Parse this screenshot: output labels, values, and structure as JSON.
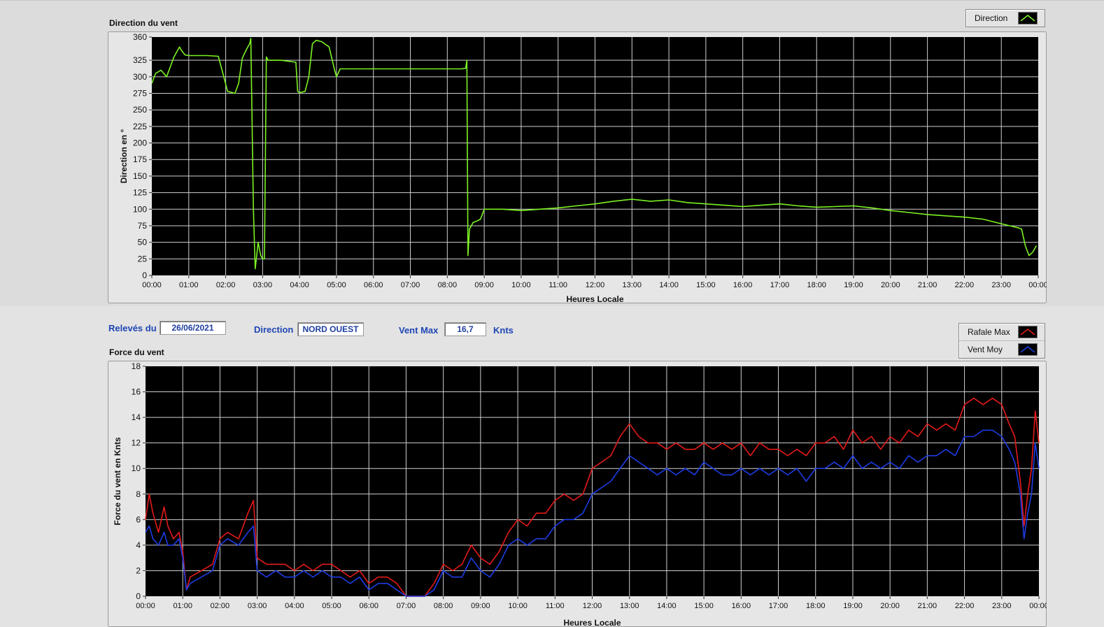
{
  "readout": {
    "date_label": "Relevés du",
    "date_value": "26/06/2021",
    "direction_label": "Direction",
    "direction_value": "NORD OUEST",
    "ventmax_label": "Vent Max",
    "ventmax_value": "16,7",
    "ventmax_unit": "Knts"
  },
  "chart_data": [
    {
      "type": "line",
      "title": "Direction du vent",
      "xlabel": "Heures Locale",
      "ylabel": "Direction en °",
      "xlim": [
        0,
        24
      ],
      "ylim": [
        0,
        360
      ],
      "x_ticks": [
        "00:00",
        "01:00",
        "02:00",
        "03:00",
        "04:00",
        "05:00",
        "06:00",
        "07:00",
        "08:00",
        "09:00",
        "10:00",
        "11:00",
        "12:00",
        "13:00",
        "14:00",
        "15:00",
        "16:00",
        "17:00",
        "18:00",
        "19:00",
        "20:00",
        "21:00",
        "22:00",
        "23:00",
        "00:00"
      ],
      "y_ticks": [
        0,
        25,
        50,
        75,
        100,
        125,
        150,
        175,
        200,
        225,
        250,
        275,
        300,
        325,
        360
      ],
      "grid": true,
      "legend_position": "top-right",
      "series": [
        {
          "name": "Direction",
          "color": "#7cf222",
          "x": [
            0,
            0.1,
            0.25,
            0.4,
            0.5,
            0.6,
            0.75,
            0.8,
            0.9,
            1.0,
            1.5,
            1.8,
            1.95,
            2.05,
            2.25,
            2.35,
            2.45,
            2.55,
            2.65,
            2.68,
            2.75,
            2.8,
            2.88,
            2.95,
            3.0,
            3.05,
            3.1,
            3.15,
            3.2,
            3.5,
            3.9,
            3.95,
            4.0,
            4.15,
            4.25,
            4.35,
            4.45,
            4.6,
            4.8,
            4.95,
            5.0,
            5.1,
            5.5,
            6.0,
            6.5,
            7.0,
            7.5,
            8.0,
            8.4,
            8.5,
            8.53,
            8.56,
            8.6,
            8.7,
            8.8,
            8.9,
            9.0,
            9.5,
            10,
            10.5,
            11,
            11.5,
            12,
            12.5,
            13,
            13.5,
            14,
            14.5,
            15,
            15.5,
            16,
            16.5,
            17,
            17.5,
            18,
            18.5,
            19,
            19.5,
            20,
            20.5,
            21,
            21.5,
            22,
            22.5,
            23,
            23.3,
            23.45,
            23.55,
            23.65,
            23.75,
            23.85,
            23.95
          ],
          "y": [
            290,
            305,
            310,
            300,
            315,
            330,
            345,
            340,
            333,
            332,
            332,
            331,
            300,
            278,
            275,
            290,
            328,
            340,
            350,
            358,
            100,
            10,
            50,
            30,
            25,
            25,
            330,
            325,
            325,
            325,
            322,
            278,
            276,
            278,
            300,
            350,
            355,
            353,
            345,
            310,
            300,
            312,
            312,
            312,
            312,
            312,
            312,
            312,
            312,
            313,
            325,
            30,
            70,
            80,
            82,
            85,
            100,
            100,
            98,
            100,
            102,
            105,
            108,
            112,
            115,
            112,
            114,
            110,
            108,
            106,
            104,
            106,
            108,
            105,
            103,
            104,
            105,
            102,
            98,
            95,
            92,
            90,
            88,
            85,
            78,
            74,
            72,
            70,
            45,
            30,
            35,
            45
          ]
        }
      ]
    },
    {
      "type": "line",
      "title": "Force du vent",
      "xlabel": "Heures Locale",
      "ylabel": "Force du vent en Knts",
      "xlim": [
        0,
        24
      ],
      "ylim": [
        0,
        18
      ],
      "x_ticks": [
        "00:00",
        "01:00",
        "02:00",
        "03:00",
        "04:00",
        "05:00",
        "06:00",
        "07:00",
        "08:00",
        "09:00",
        "10:00",
        "11:00",
        "12:00",
        "13:00",
        "14:00",
        "15:00",
        "16:00",
        "17:00",
        "18:00",
        "19:00",
        "20:00",
        "21:00",
        "22:00",
        "23:00",
        "00:00"
      ],
      "y_ticks": [
        0,
        2,
        4,
        6,
        8,
        10,
        12,
        14,
        16,
        18
      ],
      "grid": true,
      "legend_position": "top-right",
      "series": [
        {
          "name": "Rafale Max",
          "color": "#e41a1a",
          "x": [
            0,
            0.1,
            0.2,
            0.35,
            0.5,
            0.6,
            0.75,
            0.9,
            1.0,
            1.1,
            1.2,
            1.5,
            1.8,
            2.0,
            2.2,
            2.5,
            2.75,
            2.9,
            3.0,
            3.25,
            3.5,
            3.75,
            4.0,
            4.25,
            4.5,
            4.75,
            5.0,
            5.25,
            5.5,
            5.75,
            6.0,
            6.25,
            6.5,
            6.75,
            7.0,
            7.25,
            7.5,
            7.75,
            8.0,
            8.25,
            8.5,
            8.75,
            9.0,
            9.25,
            9.5,
            9.75,
            10,
            10.25,
            10.5,
            10.75,
            11,
            11.25,
            11.5,
            11.75,
            12,
            12.25,
            12.5,
            12.75,
            13,
            13.25,
            13.5,
            13.75,
            14,
            14.25,
            14.5,
            14.75,
            15,
            15.25,
            15.5,
            15.75,
            16,
            16.25,
            16.5,
            16.75,
            17,
            17.25,
            17.5,
            17.75,
            18,
            18.25,
            18.5,
            18.75,
            19,
            19.25,
            19.5,
            19.75,
            20,
            20.25,
            20.5,
            20.75,
            21,
            21.25,
            21.5,
            21.75,
            22,
            22.25,
            22.5,
            22.75,
            23,
            23.2,
            23.35,
            23.5,
            23.6,
            23.7,
            23.8,
            23.9,
            24
          ],
          "y": [
            6,
            8,
            6.5,
            5,
            7,
            5.5,
            4.5,
            5,
            3.5,
            0.5,
            1.5,
            2,
            2.5,
            4.5,
            5,
            4.5,
            6.5,
            7.5,
            3,
            2.5,
            2.5,
            2.5,
            2,
            2.5,
            2,
            2.5,
            2.5,
            2,
            1.5,
            2,
            1,
            1.5,
            1.5,
            1,
            0,
            0,
            0,
            1,
            2.5,
            2,
            2.5,
            4,
            3,
            2.5,
            3.5,
            5,
            6,
            5.5,
            6.5,
            6.5,
            7.5,
            8,
            7.5,
            8,
            10,
            10.5,
            11,
            12.5,
            13.5,
            12.5,
            12,
            12,
            11.5,
            12,
            11.5,
            11.5,
            12,
            11.5,
            12,
            11.5,
            12,
            11,
            12,
            11.5,
            11.5,
            11,
            11.5,
            11,
            12,
            12,
            12.5,
            11.5,
            13,
            12,
            12.5,
            11.5,
            12.5,
            12,
            13,
            12.5,
            13.5,
            13,
            13.5,
            13,
            15,
            15.5,
            15,
            15.5,
            15,
            13.5,
            12.5,
            9,
            5.5,
            8,
            10,
            14.5,
            12
          ]
        },
        {
          "name": "Vent Moy",
          "color": "#1e3ce6",
          "x": [
            0,
            0.1,
            0.2,
            0.35,
            0.5,
            0.6,
            0.75,
            0.9,
            1.0,
            1.1,
            1.2,
            1.5,
            1.8,
            2.0,
            2.2,
            2.5,
            2.75,
            2.9,
            3.0,
            3.25,
            3.5,
            3.75,
            4.0,
            4.25,
            4.5,
            4.75,
            5.0,
            5.25,
            5.5,
            5.75,
            6.0,
            6.25,
            6.5,
            6.75,
            7.0,
            7.25,
            7.5,
            7.75,
            8.0,
            8.25,
            8.5,
            8.75,
            9.0,
            9.25,
            9.5,
            9.75,
            10,
            10.25,
            10.5,
            10.75,
            11,
            11.25,
            11.5,
            11.75,
            12,
            12.25,
            12.5,
            12.75,
            13,
            13.25,
            13.5,
            13.75,
            14,
            14.25,
            14.5,
            14.75,
            15,
            15.25,
            15.5,
            15.75,
            16,
            16.25,
            16.5,
            16.75,
            17,
            17.25,
            17.5,
            17.75,
            18,
            18.25,
            18.5,
            18.75,
            19,
            19.25,
            19.5,
            19.75,
            20,
            20.25,
            20.5,
            20.75,
            21,
            21.25,
            21.5,
            21.75,
            22,
            22.25,
            22.5,
            22.75,
            23,
            23.2,
            23.35,
            23.5,
            23.6,
            23.7,
            23.8,
            23.9,
            24
          ],
          "y": [
            5,
            5.5,
            4.5,
            4,
            5,
            4,
            4,
            4.5,
            3,
            0.5,
            1,
            1.5,
            2,
            4,
            4.5,
            4,
            5,
            5.5,
            2,
            1.5,
            2,
            1.5,
            1.5,
            2,
            1.5,
            2,
            1.5,
            1.5,
            1,
            1.5,
            0.5,
            1,
            1,
            0.5,
            0,
            0,
            0,
            0.5,
            2,
            1.5,
            1.5,
            3,
            2,
            1.5,
            2.5,
            4,
            4.5,
            4,
            4.5,
            4.5,
            5.5,
            6,
            6,
            6.5,
            8,
            8.5,
            9,
            10,
            11,
            10.5,
            10,
            9.5,
            10,
            9.5,
            10,
            9.5,
            10.5,
            10,
            9.5,
            9.5,
            10,
            9.5,
            10,
            9.5,
            10,
            9.5,
            10,
            9,
            10,
            10,
            10.5,
            10,
            11,
            10,
            10.5,
            10,
            10.5,
            10,
            11,
            10.5,
            11,
            11,
            11.5,
            11,
            12.5,
            12.5,
            13,
            13,
            12.5,
            11.5,
            10.5,
            8,
            4.5,
            6.5,
            8,
            12,
            10
          ]
        }
      ]
    }
  ]
}
